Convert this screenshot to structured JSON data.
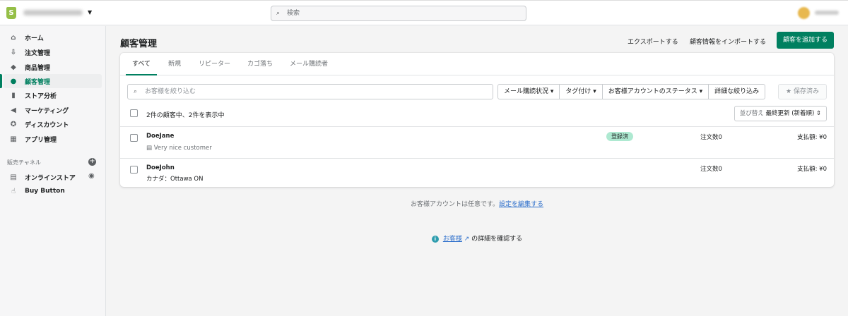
{
  "topbar": {
    "logo": "S",
    "search_placeholder": "検索"
  },
  "sidebar": {
    "items": [
      {
        "label": "ホーム",
        "icon": "home-icon",
        "glyph": "⌂"
      },
      {
        "label": "注文管理",
        "icon": "orders-icon",
        "glyph": "⇩"
      },
      {
        "label": "商品管理",
        "icon": "tag-icon",
        "glyph": "◆"
      },
      {
        "label": "顧客管理",
        "icon": "person-icon",
        "glyph": "●"
      },
      {
        "label": "ストア分析",
        "icon": "analytics-icon",
        "glyph": "▮"
      },
      {
        "label": "マーケティング",
        "icon": "megaphone-icon",
        "glyph": "◀"
      },
      {
        "label": "ディスカウント",
        "icon": "discount-icon",
        "glyph": "✪"
      },
      {
        "label": "アプリ管理",
        "icon": "apps-icon",
        "glyph": "▦"
      }
    ],
    "channels_label": "販売チャネル",
    "channels": [
      {
        "label": "オンラインストア",
        "icon": "store-icon",
        "glyph": "▤"
      },
      {
        "label": "Buy Button",
        "icon": "buy-button-icon",
        "glyph": "☝"
      }
    ]
  },
  "page": {
    "title": "顧客管理",
    "export": "エクスポートする",
    "import": "顧客情報をインポートする",
    "add": "顧客を追加する"
  },
  "tabs": [
    "すべて",
    "新規",
    "リピーター",
    "カゴ落ち",
    "メール購読者"
  ],
  "filters": {
    "placeholder": "お客様を絞り込む",
    "buttons": [
      "メール購読状況 ▾",
      "タグ付け ▾",
      "お客様アカウントのステータス ▾",
      "詳細な絞り込み"
    ],
    "saved": "保存済み"
  },
  "list": {
    "count": "2件の顧客中、2件を表示中",
    "sort_label": "並び替え",
    "sort_value": "最終更新 (新着順) ⇕"
  },
  "customers": [
    {
      "name": "DoeJane",
      "note": "Very nice customer",
      "badge": "登録済",
      "orders": "注文数0",
      "spent": "支払額: ¥0"
    },
    {
      "name": "DoeJohn",
      "location": "カナダ：Ottawa ON",
      "orders": "注文数0",
      "spent": "支払額: ¥0"
    }
  ],
  "footer": {
    "text": "お客様アカウントは任意です。",
    "link": "設定を編集する",
    "learn_link": "お客様",
    "learn_suffix": "の詳細を確認する"
  }
}
